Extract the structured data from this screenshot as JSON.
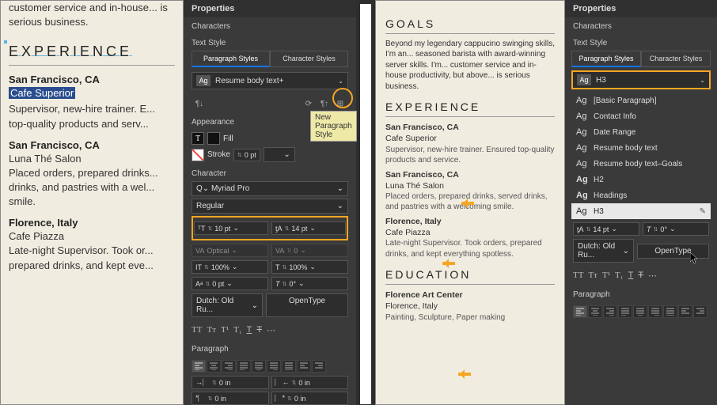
{
  "doc_left": {
    "top_text": "customer service and in-house... is serious business.",
    "heading_exp": "EXPERIENCE",
    "jobs": [
      {
        "loc": "San Francisco, CA",
        "name": "Cafe Superior",
        "is_sel": true,
        "desc": "Supervisor, new-hire trainer. E... top-quality products and serv..."
      },
      {
        "loc": "San Francisco, CA",
        "name": "Luna Thé Salon",
        "desc": "Placed orders, prepared drinks... drinks, and pastries with a wel... smile."
      },
      {
        "loc": "Florence, Italy",
        "name": "Cafe Piazza",
        "desc": "Late-night Supervisor. Took or... prepared drinks, and kept eve..."
      }
    ]
  },
  "panel_left": {
    "title": "Properties",
    "char_h": "Characters",
    "textstyle_h": "Text Style",
    "tabs": [
      "Paragraph Styles",
      "Character Styles"
    ],
    "style_name": "Resume body text+",
    "tooltip": "New Paragraph Style",
    "appearance_h": "Appearance",
    "fill": "Fill",
    "stroke": "Stroke",
    "stroke_val": "0 pt",
    "char_sec_h": "Character",
    "font": "Myriad Pro",
    "weight": "Regular",
    "fontsize": "10 pt",
    "leading": "14 pt",
    "kerning": "Optical",
    "tracking": "0",
    "vscale": "100%",
    "hscale": "100%",
    "baseline": "0 pt",
    "skew": "0°",
    "lang": "Dutch: Old Ru...",
    "opentype": "OpenType",
    "para_h": "Paragraph",
    "indent": "0 in"
  },
  "doc_right": {
    "top": "Beyond my legendary cappucino swinging skills, I'm an... seasoned barista with award-winning server skills. I'm... customer service and in-house productivity, but above... is serious business.",
    "goals_h": "GOALS",
    "exp_h": "EXPERIENCE",
    "edu_h": "EDUCATION",
    "jobs": [
      {
        "loc": "San Francisco, CA",
        "name": "Cafe Superior",
        "desc": "Supervisor, new-hire trainer. Ensured top-quality products and service."
      },
      {
        "loc": "San Francisco, CA",
        "name": "Luna Thé Salon",
        "desc": "Placed orders, prepared drinks, served drinks, and pastries with a welcoming smile."
      },
      {
        "loc": "Florence, Italy",
        "name": "Cafe Piazza",
        "desc": "Late-night Supervisor. Took orders, prepared drinks, and kept everything spotless."
      }
    ],
    "edu": [
      {
        "name": "Florence Art Center",
        "loc": "Florence, Italy",
        "desc": "Painting, Sculpture, Paper making"
      }
    ]
  },
  "panel_right": {
    "title": "Properties",
    "char_h": "Characters",
    "textstyle_h": "Text Style",
    "tabs": [
      "Paragraph Styles",
      "Character Styles"
    ],
    "style_name": "H3",
    "styles": [
      "[Basic Paragraph]",
      "Contact Info",
      "Date Range",
      "Resume body text",
      "Resume body text–Goals",
      "H2",
      "Headings",
      "H3"
    ],
    "leading": "14 pt",
    "skew": "0°",
    "lang": "Dutch: Old Ru...",
    "opentype": "OpenType",
    "para_h": "Paragraph"
  }
}
